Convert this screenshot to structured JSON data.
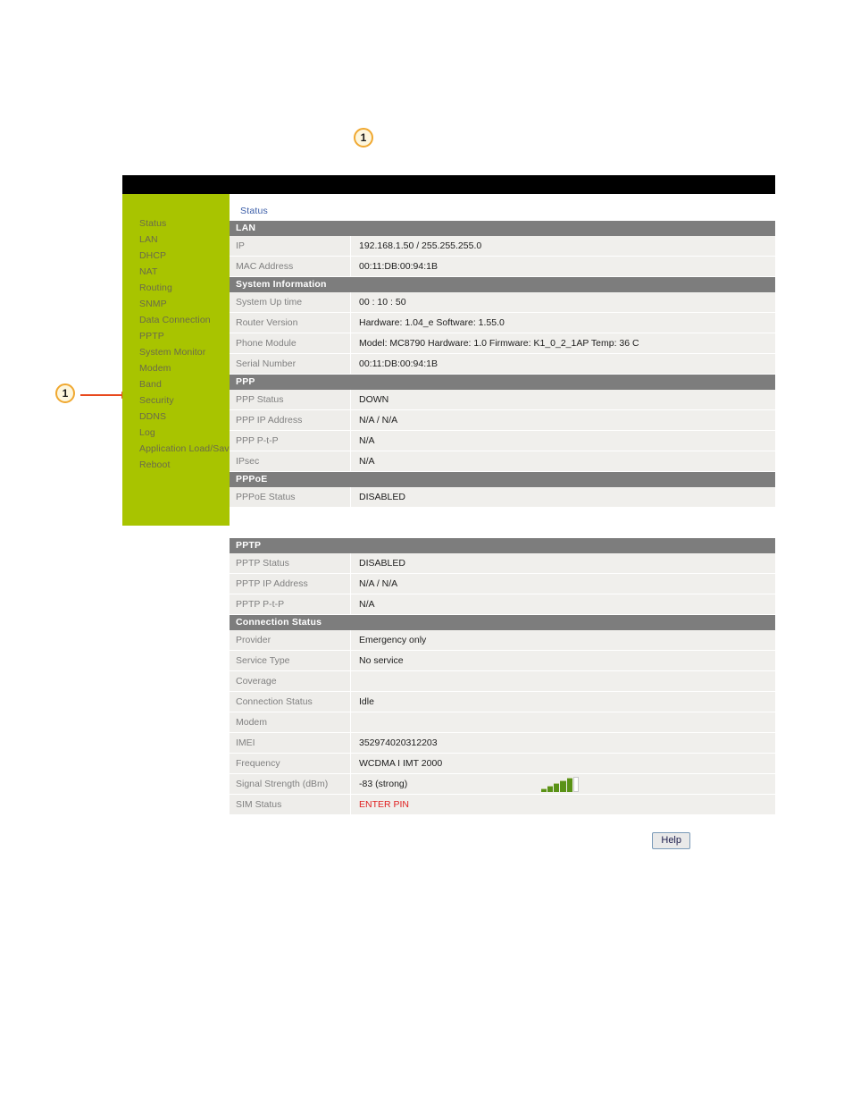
{
  "callouts": {
    "top_marker": "1",
    "left_marker": "1"
  },
  "window": {
    "tab_label": "Status"
  },
  "sidebar": {
    "items": [
      {
        "label": "Status"
      },
      {
        "label": "LAN"
      },
      {
        "label": "DHCP"
      },
      {
        "label": "NAT"
      },
      {
        "label": "Routing"
      },
      {
        "label": "SNMP"
      },
      {
        "label": "Data Connection"
      },
      {
        "label": "PPTP"
      },
      {
        "label": "System Monitor"
      },
      {
        "label": "Modem"
      },
      {
        "label": "Band"
      },
      {
        "label": "Security"
      },
      {
        "label": "DDNS"
      },
      {
        "label": "Log"
      },
      {
        "label": "Application Load/Save"
      },
      {
        "label": "Reboot"
      }
    ]
  },
  "sections_top": [
    {
      "title": "LAN",
      "rows": [
        {
          "label": "IP",
          "value": "192.168.1.50  /  255.255.255.0"
        },
        {
          "label": "MAC Address",
          "value": "00:11:DB:00:94:1B"
        }
      ]
    },
    {
      "title": "System Information",
      "rows": [
        {
          "label": "System Up time",
          "value": "00 : 10 : 50"
        },
        {
          "label": "Router Version",
          "value": "Hardware:  1.04_e   Software:  1.55.0"
        },
        {
          "label": "Phone Module",
          "value": "Model:  MC8790   Hardware:  1.0   Firmware:  K1_0_2_1AP   Temp: 36 C"
        },
        {
          "label": "Serial Number",
          "value": "00:11:DB:00:94:1B"
        }
      ]
    },
    {
      "title": "PPP",
      "rows": [
        {
          "label": "PPP Status",
          "value": "DOWN"
        },
        {
          "label": "PPP IP Address",
          "value": "N/A  /  N/A"
        },
        {
          "label": "PPP P-t-P",
          "value": "N/A"
        },
        {
          "label": "IPsec",
          "value": "N/A"
        }
      ]
    },
    {
      "title": "PPPoE",
      "rows": [
        {
          "label": "PPPoE Status",
          "value": "DISABLED"
        }
      ]
    }
  ],
  "sections_bottom": [
    {
      "title": "PPTP",
      "rows": [
        {
          "label": "PPTP Status",
          "value": "DISABLED"
        },
        {
          "label": "PPTP IP Address",
          "value": "N/A  /  N/A"
        },
        {
          "label": "PPTP P-t-P",
          "value": "N/A"
        }
      ]
    },
    {
      "title": "Connection Status",
      "rows": [
        {
          "label": "Provider",
          "value": "Emergency only"
        },
        {
          "label": "Service Type",
          "value": "No service"
        },
        {
          "label": "Coverage",
          "value": ""
        },
        {
          "label": "Connection Status",
          "value": "Idle"
        },
        {
          "label": "Modem",
          "value": ""
        },
        {
          "label": "IMEI",
          "value": "352974020312203"
        },
        {
          "label": "Frequency",
          "value": "WCDMA I IMT 2000"
        },
        {
          "label": "Signal Strength (dBm)",
          "value": "-83 (strong)",
          "signal": true
        },
        {
          "label": "SIM Status",
          "value": "ENTER PIN",
          "alert": true
        }
      ]
    }
  ],
  "signal_meter": {
    "bars": [
      {
        "height": 3,
        "filled": true
      },
      {
        "height": 6,
        "filled": true
      },
      {
        "height": 9,
        "filled": true
      },
      {
        "height": 12,
        "filled": true
      },
      {
        "height": 15,
        "filled": true
      },
      {
        "height": 17,
        "filled": false
      }
    ]
  },
  "footer": {
    "help_label": "Help"
  },
  "colors": {
    "sidebar_green": "#a8c400",
    "section_gray": "#7d7d7d",
    "row_bg": "#eeedea",
    "alert_red": "#e02020",
    "tab_blue": "#3b5ea8",
    "callout_orange": "#f0a830",
    "arrow_orange": "#e8491d",
    "signal_green": "#5a9216"
  }
}
